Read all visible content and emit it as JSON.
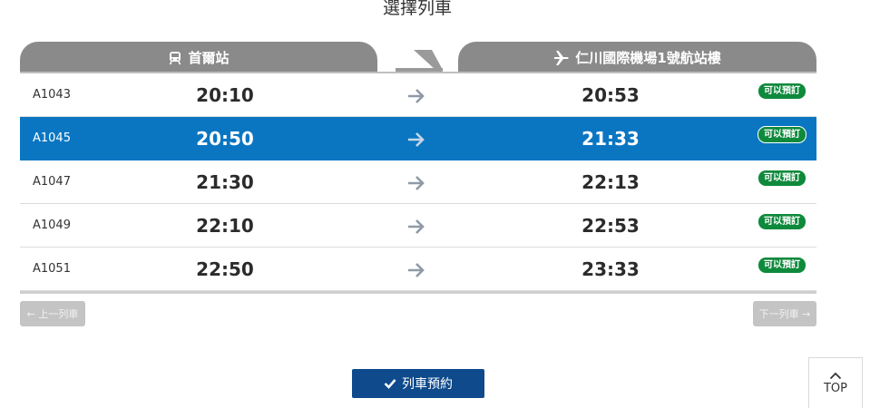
{
  "page": {
    "title": "選擇列車"
  },
  "header": {
    "departure_station": "首爾站",
    "arrival_station": "仁川國際機場1號航站樓",
    "departure_icon": "train-icon",
    "arrival_icon": "airplane-icon"
  },
  "trains": [
    {
      "code": "A1043",
      "departure": "20:10",
      "arrival": "20:53",
      "status": "可以預訂",
      "selected": false
    },
    {
      "code": "A1045",
      "departure": "20:50",
      "arrival": "21:33",
      "status": "可以預訂",
      "selected": true
    },
    {
      "code": "A1047",
      "departure": "21:30",
      "arrival": "22:13",
      "status": "可以預訂",
      "selected": false
    },
    {
      "code": "A1049",
      "departure": "22:10",
      "arrival": "22:53",
      "status": "可以預訂",
      "selected": false
    },
    {
      "code": "A1051",
      "departure": "22:50",
      "arrival": "23:33",
      "status": "可以預訂",
      "selected": false
    }
  ],
  "pager": {
    "prev_label": "上一列車",
    "next_label": "下一列車"
  },
  "actions": {
    "book_label": "列車預約",
    "top_label": "TOP"
  },
  "colors": {
    "selected_row": "#0a76c2",
    "badge": "#0f8a3c",
    "book_button": "#0e4a8c",
    "header_tab": "#8a8a8a"
  }
}
